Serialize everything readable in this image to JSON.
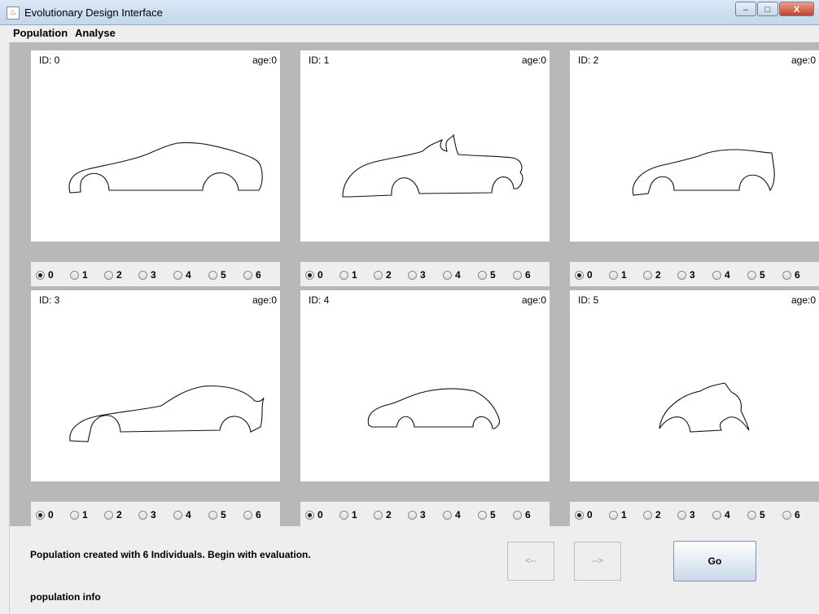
{
  "window": {
    "title": "Evolutionary Design Interface",
    "min_icon": "minimize-icon",
    "max_icon": "maximize-icon",
    "close_label": "X"
  },
  "menu": [
    {
      "label": "Population"
    },
    {
      "label": "Analyse"
    }
  ],
  "individuals": [
    {
      "id_label": "ID: 0",
      "age_label": "age:0",
      "selected": "0"
    },
    {
      "id_label": "ID: 1",
      "age_label": "age:0",
      "selected": "0"
    },
    {
      "id_label": "ID: 2",
      "age_label": "age:0",
      "selected": "0"
    },
    {
      "id_label": "ID: 3",
      "age_label": "age:0",
      "selected": "0"
    },
    {
      "id_label": "ID: 4",
      "age_label": "age:0",
      "selected": "0"
    },
    {
      "id_label": "ID: 5",
      "age_label": "age:0",
      "selected": "0"
    }
  ],
  "rating_options": [
    "0",
    "1",
    "2",
    "3",
    "4",
    "5",
    "6"
  ],
  "status_text": "Population created with 6 Individuals. Begin with evaluation.",
  "population_info": "population info",
  "buttons": {
    "prev_label": "<--",
    "next_label": "-->",
    "go_label": "Go"
  },
  "colors": {
    "titlebar": "#c3d6ec",
    "grid_background": "#b8b8b8",
    "panel": "#eeeeee",
    "go_button": "#cad9ea"
  }
}
